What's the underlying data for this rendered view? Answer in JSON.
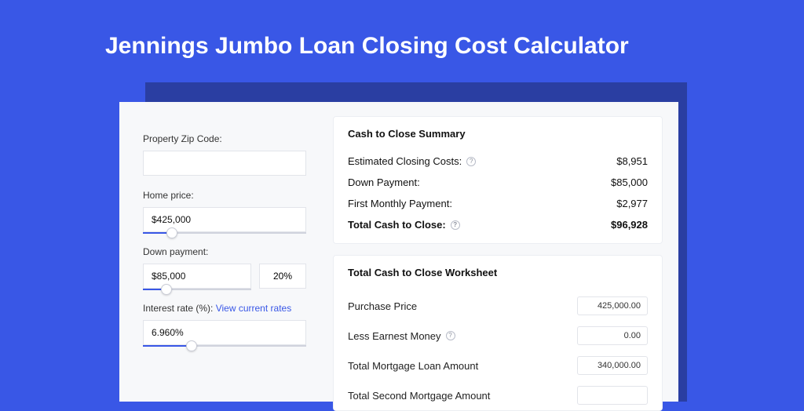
{
  "title": "Jennings Jumbo Loan Closing Cost Calculator",
  "inputs": {
    "zip": {
      "label": "Property Zip Code:",
      "value": ""
    },
    "price": {
      "label": "Home price:",
      "value": "$425,000",
      "slider_pct": 18
    },
    "down": {
      "label": "Down payment:",
      "value": "$85,000",
      "pct": "20%",
      "slider_pct": 22
    },
    "rate": {
      "label": "Interest rate (%):",
      "link": "View current rates",
      "value": "6.960%",
      "slider_pct": 30
    }
  },
  "summary": {
    "title": "Cash to Close Summary",
    "rows": [
      {
        "label": "Estimated Closing Costs:",
        "help": true,
        "value": "$8,951"
      },
      {
        "label": "Down Payment:",
        "help": false,
        "value": "$85,000"
      },
      {
        "label": "First Monthly Payment:",
        "help": false,
        "value": "$2,977"
      }
    ],
    "total": {
      "label": "Total Cash to Close:",
      "help": true,
      "value": "$96,928"
    }
  },
  "worksheet": {
    "title": "Total Cash to Close Worksheet",
    "rows": [
      {
        "label": "Purchase Price",
        "help": false,
        "value": "425,000.00"
      },
      {
        "label": "Less Earnest Money",
        "help": true,
        "value": "0.00"
      },
      {
        "label": "Total Mortgage Loan Amount",
        "help": false,
        "value": "340,000.00"
      },
      {
        "label": "Total Second Mortgage Amount",
        "help": false,
        "value": ""
      }
    ]
  }
}
